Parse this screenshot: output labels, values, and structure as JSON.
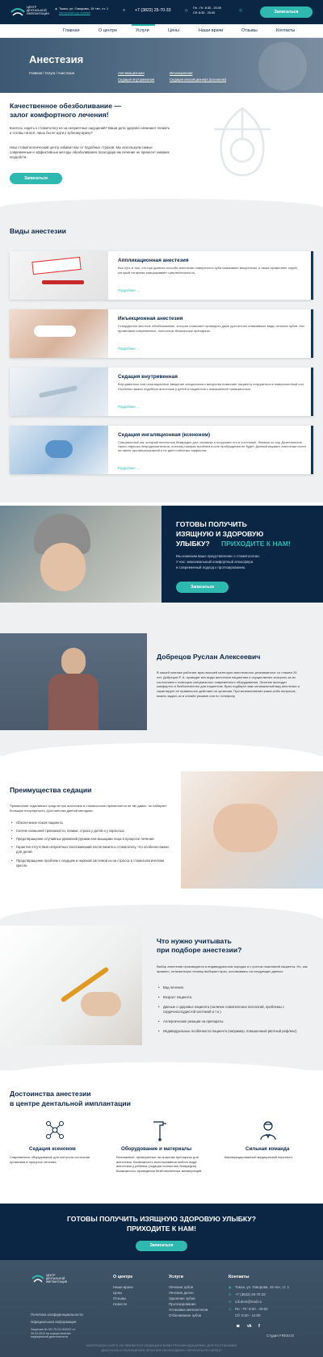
{
  "header": {
    "logo_lines": [
      "ЦЕНТР",
      "ДЕНТАЛЬНОЙ",
      "ИМПЛАНТАЦИИ"
    ],
    "address": "Томск, ул. Говорова, 19 «в», ст. 1",
    "route_link": "Как проехать до клиники",
    "phone": "+7 (3822) 25-70-33",
    "hours_1": "Пн - Пт: 8:30 - 20:00",
    "hours_2": "Сб: 8:30 - 20:00",
    "cta": "Записаться"
  },
  "nav": [
    "Главная",
    "О центре",
    "Услуги",
    "Цены",
    "Наши врачи",
    "Отзывы",
    "Контакты"
  ],
  "hero": {
    "title": "Анестезия",
    "breadcrumb": "Главная / Услуги / Анестезия",
    "links": [
      "Аппликационная",
      "Седация внутривенная",
      "Инъекционная",
      "Седация ингаляционная (ксеноном)"
    ]
  },
  "intro": {
    "heading_line1": "Качественное обезболивание —",
    "heading_line2": "залог комфортного лечения!",
    "text1": "Боитесь ходить к стоматологу из-за неприятных ощущений? Ваши дети здорово начинают плакать и готовы на всё, лишь бы не идти к зубному врачу?",
    "text2": "Наш стоматологический центр избавит вас от подобных страхов. Мы используем самые современные и эффективные методы обезболивания. Благодаря им лечение не принесет никаких неудобств.",
    "button": "Записаться"
  },
  "types": {
    "heading": "Виды анестезии",
    "more": "Подробнее →",
    "items": [
      {
        "title": "Аппликационная анестезия",
        "text": "Вся суть в том, что при данном способе анестезии поверхность зуба смазывают веществом, а также применяют спрей, который на время замораживает чувствительность."
      },
      {
        "title": "Инъекционная анестезия",
        "text": "Стандартное местное обезболивание, которое позволяет проводить даже достаточно инвазивные виды лечения зубов. Мы применяем современные, полностью безопасные препараты."
      },
      {
        "title": "Седация внутривенная",
        "text": "Внутривенное или ингаляционное введение специального вещества позволяет пациенту погрузиться в поверхностный сон. Особенно важно подобное анестезии у детей и пациентов с повышенной тревожностью."
      },
      {
        "title": "Седация ингаляционная (ксеноном)",
        "text": "Специальный газ, который полностью безвреден для человека и погружает его в состояние, близкое ко сну. Деятельность такого наркоза непродолжительна, поэтому никаких проблем после пробуждения не будет. Данный вариант анестезии почти не имеет противопоказаний и не дает побочных эффектов."
      }
    ]
  },
  "promo": {
    "heading_1": "ГОТОВЫ ПОЛУЧИТЬ",
    "heading_2": "ИЗЯЩНУЮ И ЗДОРОВУЮ",
    "heading_3": "УЛЫБКУ?",
    "heading_accent": "ПРИХОДИТЕ К НАМ!",
    "sub_1": "Мы изменим ваше представление о стоматологии.",
    "sub_2": "У нас: максимальный комфортный атмосфера",
    "sub_3": "и современный подход к протезированию.",
    "button": "Записаться"
  },
  "doctor": {
    "name": "Добрецов Руслан Алексеевич",
    "text": "В нашей клинике работает врач высшей категории анестезиолог-реаниматолог со стажем 26 лет. Добрецов Р. А. проводит все виды анестезии пациентам и осуществляет контроль за их состоянием с помощью специального современного оборудования. Лечение проходит комфортно и безболезненно для пациентов. Врач подберет вам оптимальный вид анестезии и гарантирует ее правильное действие на организм. При возникновении каких-либо вопросов, можно задать их в онлайн режиме или по телефону."
  },
  "sedation": {
    "heading": "Преимущества седации",
    "intro": "Применение седативных средств при анестезии в стоматологии применяется не так давно, но набирает большую популярность. Достоинства данной методики:",
    "items": [
      "Обеспечение покоя пациента.",
      "Снятие излишней тревожности, паники, страха у детей и у взрослых.",
      "Предотвращение случайных движений руками или мышцами лица в процессе лечения.",
      "Гарантия отсутствия неприятных воспоминаний после визита к стоматологу, что особенно важно для детей.",
      "Предотвращение проблем с сердцем и нервной системой из-за стресса в стоматологическом кресле."
    ]
  },
  "choose": {
    "heading_line1": "Что нужно учитывать",
    "heading_line2": "при подборе анестезии?",
    "intro": "Выбор анестезии производится в индивидуальном порядке и с учетом пожеланий пациента. Но, как правило, оптимальную технику выбирает врач, основываясь на следующих данных:",
    "items": [
      "Вид лечения.",
      "Возраст пациента.",
      "Данные о здоровье пациента (наличие соматических патологий, проблемы с сердечнососудистой системой и т.п.).",
      "Аллергические реакции на препараты.",
      "Индивидуальные особенности пациента (например, повышенный рвотный рефлекс)."
    ]
  },
  "benefits": {
    "heading_line1": "Достоинства анестезии",
    "heading_line2": "в центре дентальной имплантации",
    "items": [
      {
        "icon": "molecule-icon",
        "title": "Седация ксеноном",
        "text": "Современное оборудование для контроля состояния организма в процессе лечения."
      },
      {
        "icon": "dental-tool-icon",
        "title": "Оборудование и материалы",
        "text": "Безопасные, проверенные на практике препараты для анестезии. Возможность использования любого вида анестезии у ребенка (седация полностью безвредна). Возможность проведения безболезненных манипуляций."
      },
      {
        "icon": "doctor-icon",
        "title": "Сильная команда",
        "text": "Квалифицированный медицинский персонал."
      }
    ]
  },
  "cta": {
    "line1": "ГОТОВЫ ПОЛУЧИТЬ ИЗЯЩНУЮ ЗДОРОВУЮ УЛЫБКУ?",
    "line2": "ПРИХОДИТЕ К НАМ!",
    "button": "Записаться"
  },
  "footer": {
    "col1_title": "О центре",
    "col1": [
      "Наши врачи",
      "Цены",
      "Отзывы",
      "Новости"
    ],
    "col2_title": "Услуги",
    "col2": [
      "Лечение зубов",
      "Лечение десен",
      "Удаление зубов",
      "Протезирование",
      "Установка имплантатов",
      "Отбеливание зубов"
    ],
    "col3_title": "Контакты",
    "address": "Томск, ул. Говорова, 19 «в», ст. 1",
    "phone": "+7 (3822) 25-70-33",
    "email": "cdi.dent@mail.ru",
    "hours_1": "Пн - Пт:   8:30 - 20:00",
    "hours_2": "Сб:   8:30 - 14:00",
    "policy": "Политика конфиденциальности",
    "official": "Официальная информация",
    "license": "Лицензия № ЛО-70-01-001007 от 25.03.2013 на осуществление медицинской деятельности",
    "studio": "Студия FRESCO",
    "disclaimer_1": "МАТЕРИАЛЫ САЙТА НЕ ЯВЛЯЮТСЯ МЕДИЦИНСКИМИ РЕКОМЕНДАЦИЯМИ, ДЛЯ ПОСТАНОВКИ",
    "disclaimer_2": "ДИАГНОЗА И НАЗНАЧЕНИЯ ЛЕЧЕНИЯ НЕОБХОДИМО ОБРАТИТЬСЯ К ВРАЧУ"
  },
  "colors": {
    "navy": "#0b2545",
    "teal": "#2fb8b0"
  }
}
